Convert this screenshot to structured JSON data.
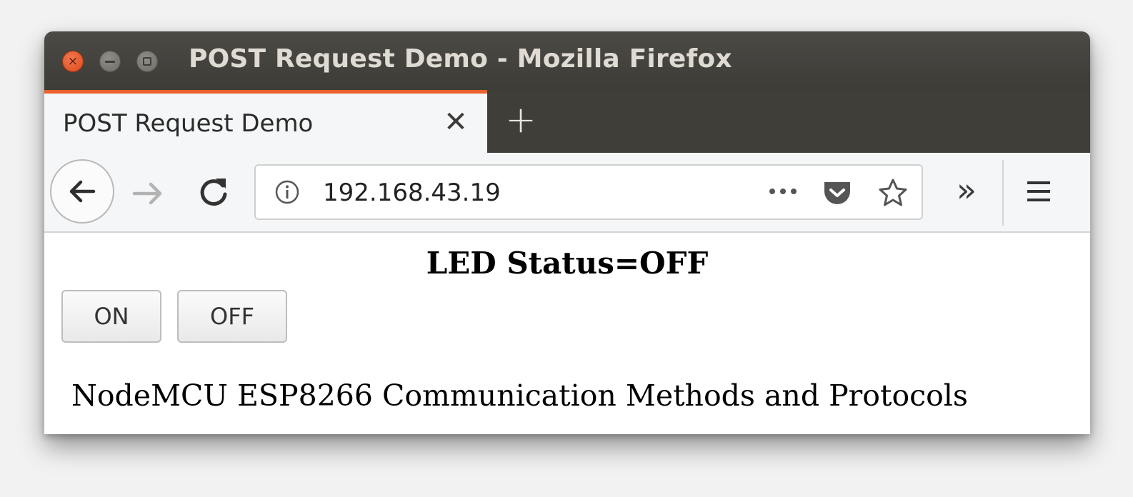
{
  "window": {
    "title": "POST Request Demo - Mozilla Firefox",
    "controls": [
      "close-icon",
      "minimize-icon",
      "maximize-icon"
    ]
  },
  "tabs": [
    {
      "label": "POST Request Demo",
      "close_glyph": "✕",
      "active": true
    }
  ],
  "new_tab_glyph": "+",
  "navbar": {
    "url": "192.168.43.19",
    "overflow_glyph": "»",
    "icons": [
      "back-arrow-icon",
      "forward-arrow-icon",
      "reload-icon",
      "info-icon",
      "more-actions-icon",
      "pocket-icon",
      "bookmark-star-icon",
      "overflow-chevron-icon",
      "hamburger-menu-icon"
    ]
  },
  "page": {
    "heading": "LED Status=OFF",
    "buttons": {
      "on_label": "ON",
      "off_label": "OFF"
    },
    "footer": "NodeMCU ESP8266 Communication Methods and Protocols"
  },
  "colors": {
    "titlebar": "#3d3c37",
    "active_tab_accent": "#e9622b",
    "close_button": "#e95420"
  }
}
